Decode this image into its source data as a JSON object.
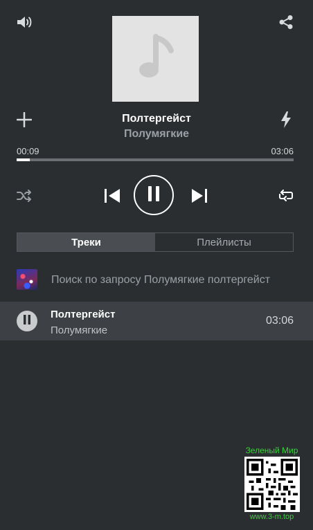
{
  "header": {
    "volume_icon": "volume-icon",
    "share_icon": "share-icon"
  },
  "cover": {
    "icon": "music-note-icon"
  },
  "now_playing": {
    "title": "Полтергейст",
    "artist": "Полумягкие"
  },
  "progress": {
    "current": "00:09",
    "total": "03:06",
    "fraction": 0.048
  },
  "controls": {
    "add_icon": "plus-icon",
    "lightning_icon": "lightning-icon",
    "shuffle_icon": "shuffle-icon",
    "prev_icon": "skip-previous-icon",
    "pause_icon": "pause-icon",
    "next_icon": "skip-next-icon",
    "repeat_icon": "repeat-icon"
  },
  "tabs": [
    {
      "label": "Треки",
      "active": true
    },
    {
      "label": "Плейлисты",
      "active": false
    }
  ],
  "search_suggestion": "Поиск по запросу Полумягкие полтергейст",
  "tracks": [
    {
      "title": "Полтергейст",
      "artist": "Полумягкие",
      "duration": "03:06",
      "state": "playing"
    }
  ],
  "watermark": {
    "top": "Зеленый Мир",
    "bottom": "www.3-m.top"
  },
  "colors": {
    "background": "#2b2e31",
    "active_row": "#3d4145",
    "accent": "#ffffff",
    "muted_text": "#9aa0a6",
    "watermark_green": "#3bd13b"
  }
}
